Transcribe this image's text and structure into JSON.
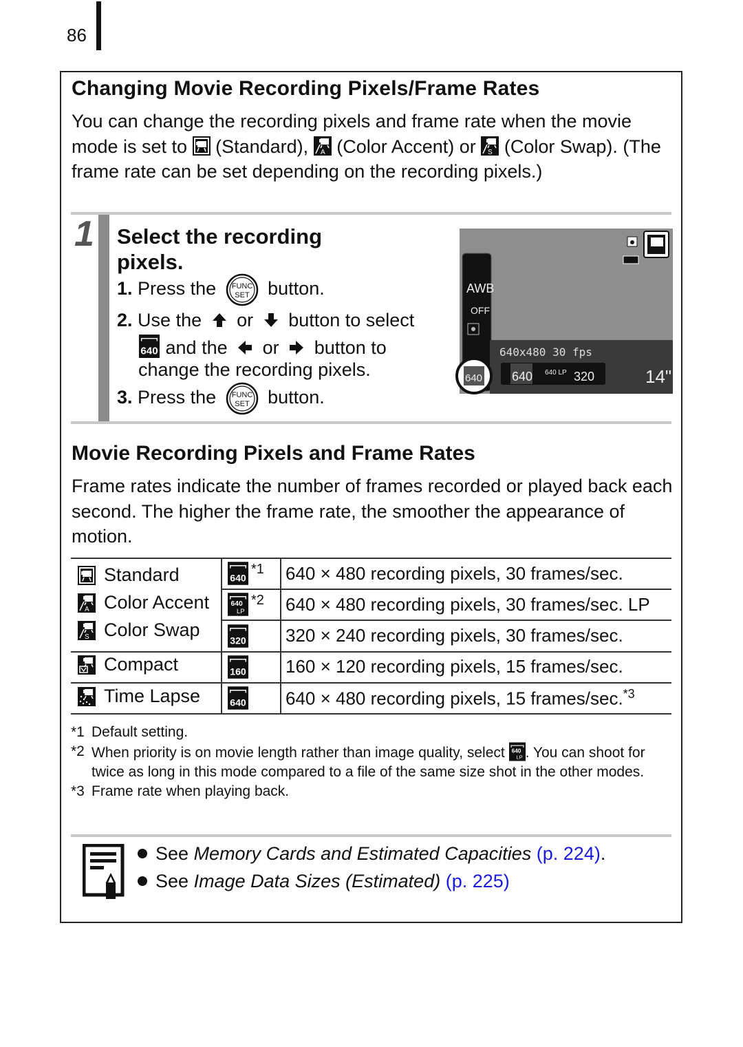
{
  "page": {
    "number": "86"
  },
  "section": {
    "title": "Changing Movie Recording Pixels/Frame Rates",
    "intro": {
      "part1": "You can change the recording pixels and frame rate when the movie mode is set to",
      "standard": "(Standard),",
      "color_accent": "(Color Accent) or",
      "color_swap": "(Color Swap). (The frame rate can be set depending on the recording pixels.)"
    }
  },
  "step": {
    "number": "1",
    "title_line1": "Select the recording",
    "title_line2": "pixels.",
    "items": [
      {
        "num": "1.",
        "pre": "Press the",
        "post": "button."
      },
      {
        "num": "2.",
        "pre": "Use the",
        "mid1": "or",
        "post1": "button to select",
        "mid2": "and the",
        "mid3": "or",
        "post2": "button to",
        "line3": "change the recording pixels."
      },
      {
        "num": "3.",
        "pre": "Press the",
        "post": "button."
      }
    ],
    "func_button": {
      "top": "FUNC",
      "bottom": "SET"
    }
  },
  "lcd": {
    "left_menu": [
      "AWB",
      "OFF"
    ],
    "resolution_label": "640x480 30 fps",
    "options": [
      "640",
      "640 LP",
      "320"
    ],
    "selected_option": "640",
    "current_icon": "640",
    "remaining_time": "14\""
  },
  "subsection": {
    "title": "Movie Recording Pixels and Frame Rates",
    "text": "Frame rates indicate the number of frames recorded or played back each second. The higher the frame rate, the smoother the appearance of motion."
  },
  "table": {
    "rows": [
      {
        "mode": "Standard",
        "mode_icon": "movie-standard",
        "res_icon": "640",
        "note": "*1",
        "desc": "640 × 480 recording pixels, 30 frames/sec."
      },
      {
        "mode": "Color Accent",
        "mode_icon": "movie-color-accent",
        "res_icon": "640 LP",
        "note": "*2",
        "desc": "640 × 480 recording pixels, 30 frames/sec. LP"
      },
      {
        "mode": "Color Swap",
        "mode_icon": "movie-color-swap",
        "res_icon": "320",
        "note": "",
        "desc": "320 × 240 recording pixels, 30 frames/sec."
      },
      {
        "mode": "Compact",
        "mode_icon": "movie-compact",
        "res_icon": "160",
        "note": "",
        "desc": "160 × 120 recording pixels, 15 frames/sec."
      },
      {
        "mode": "Time Lapse",
        "mode_icon": "movie-time-lapse",
        "res_icon": "640",
        "note": "",
        "desc": "640 × 480 recording pixels, 15 frames/sec.",
        "desc_note": "*3"
      }
    ]
  },
  "footnotes": [
    {
      "mark": "*1",
      "text": "Default setting."
    },
    {
      "mark": "*2",
      "text_pre": "When priority is on movie length rather than image quality, select",
      "text_post": ". You can shoot for twice as long in this mode compared to a file of the same size shot in the other modes."
    },
    {
      "mark": "*3",
      "text": "Frame rate when playing back."
    }
  ],
  "references": [
    {
      "pre": "See",
      "title": "Memory Cards and Estimated Capacities",
      "link": "(p. 224)",
      "post": "."
    },
    {
      "pre": "See",
      "title": "Image Data Sizes (Estimated)",
      "link": "(p. 225)",
      "post": ""
    }
  ],
  "colors": {
    "link": "#1a1adc",
    "rule": "#c8c8c8",
    "step_bar": "#8a8a8a",
    "lcd_bg": "#8e8e8e"
  }
}
